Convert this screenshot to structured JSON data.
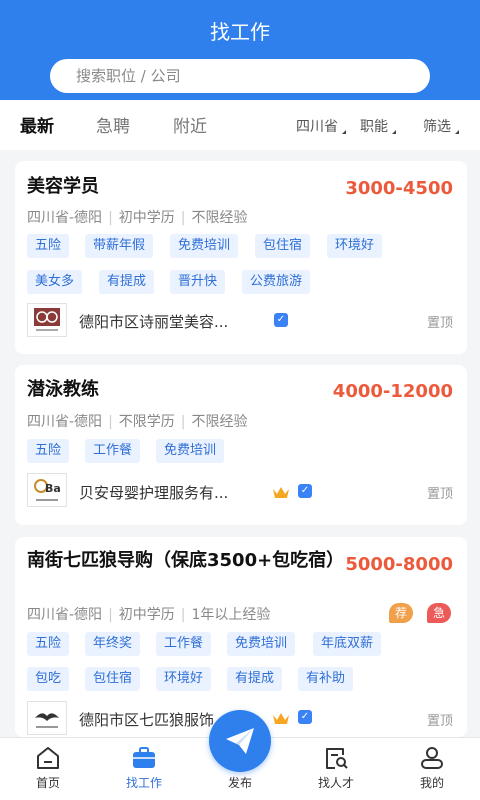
{
  "header": {
    "title": "找工作",
    "search_placeholder": "搜索职位 / 公司"
  },
  "tabs": [
    {
      "label": "最新",
      "active": true
    },
    {
      "label": "急聘",
      "active": false
    },
    {
      "label": "附近",
      "active": false
    }
  ],
  "filters": [
    {
      "label": "四川省"
    },
    {
      "label": "职能"
    },
    {
      "label": "筛选"
    }
  ],
  "jobs": [
    {
      "title": "美容学员",
      "salary": "3000-4500",
      "location": "四川省-德阳",
      "education": "初中学历",
      "experience": "不限经验",
      "tags": [
        "五险",
        "带薪年假",
        "免费培训",
        "包住宿",
        "环境好",
        "美女多",
        "有提成",
        "晋升快",
        "公费旅游"
      ],
      "company": "德阳市区诗丽堂美容...",
      "verified": true,
      "vip": false,
      "pin_label": "置顶"
    },
    {
      "title": "潜泳教练",
      "salary": "4000-12000",
      "location": "四川省-德阳",
      "education": "不限学历",
      "experience": "不限经验",
      "tags": [
        "五险",
        "工作餐",
        "免费培训"
      ],
      "company": "贝安母婴护理服务有...",
      "verified": true,
      "vip": true,
      "pin_label": "置顶"
    },
    {
      "title": "南街七匹狼导购（保底3500+包吃宿）",
      "salary": "5000-8000",
      "location": "四川省-德阳",
      "education": "初中学历",
      "experience": "1年以上经验",
      "badges": [
        {
          "label": "荐",
          "color": "#f0a04b"
        },
        {
          "label": "急",
          "color": "#ec5a5a"
        }
      ],
      "tags": [
        "五险",
        "年终奖",
        "工作餐",
        "免费培训",
        "年底双薪",
        "包吃",
        "包住宿",
        "环境好",
        "有提成",
        "有补助"
      ],
      "company": "德阳市区七匹狼服饰...",
      "verified": true,
      "vip": true,
      "pin_label": "置顶"
    }
  ],
  "bottom_nav": [
    {
      "label": "首页",
      "icon": "home-icon",
      "active": false
    },
    {
      "label": "找工作",
      "icon": "briefcase-icon",
      "active": true
    },
    {
      "label": "发布",
      "icon": "send-icon",
      "active": false
    },
    {
      "label": "找人才",
      "icon": "talent-search-icon",
      "active": false
    },
    {
      "label": "我的",
      "icon": "profile-icon",
      "active": false
    }
  ],
  "colors": {
    "primary": "#2f80ed",
    "salary": "#ec5a3b",
    "tag_bg": "#eaf2ff",
    "tag_text": "#2f6fd6"
  }
}
